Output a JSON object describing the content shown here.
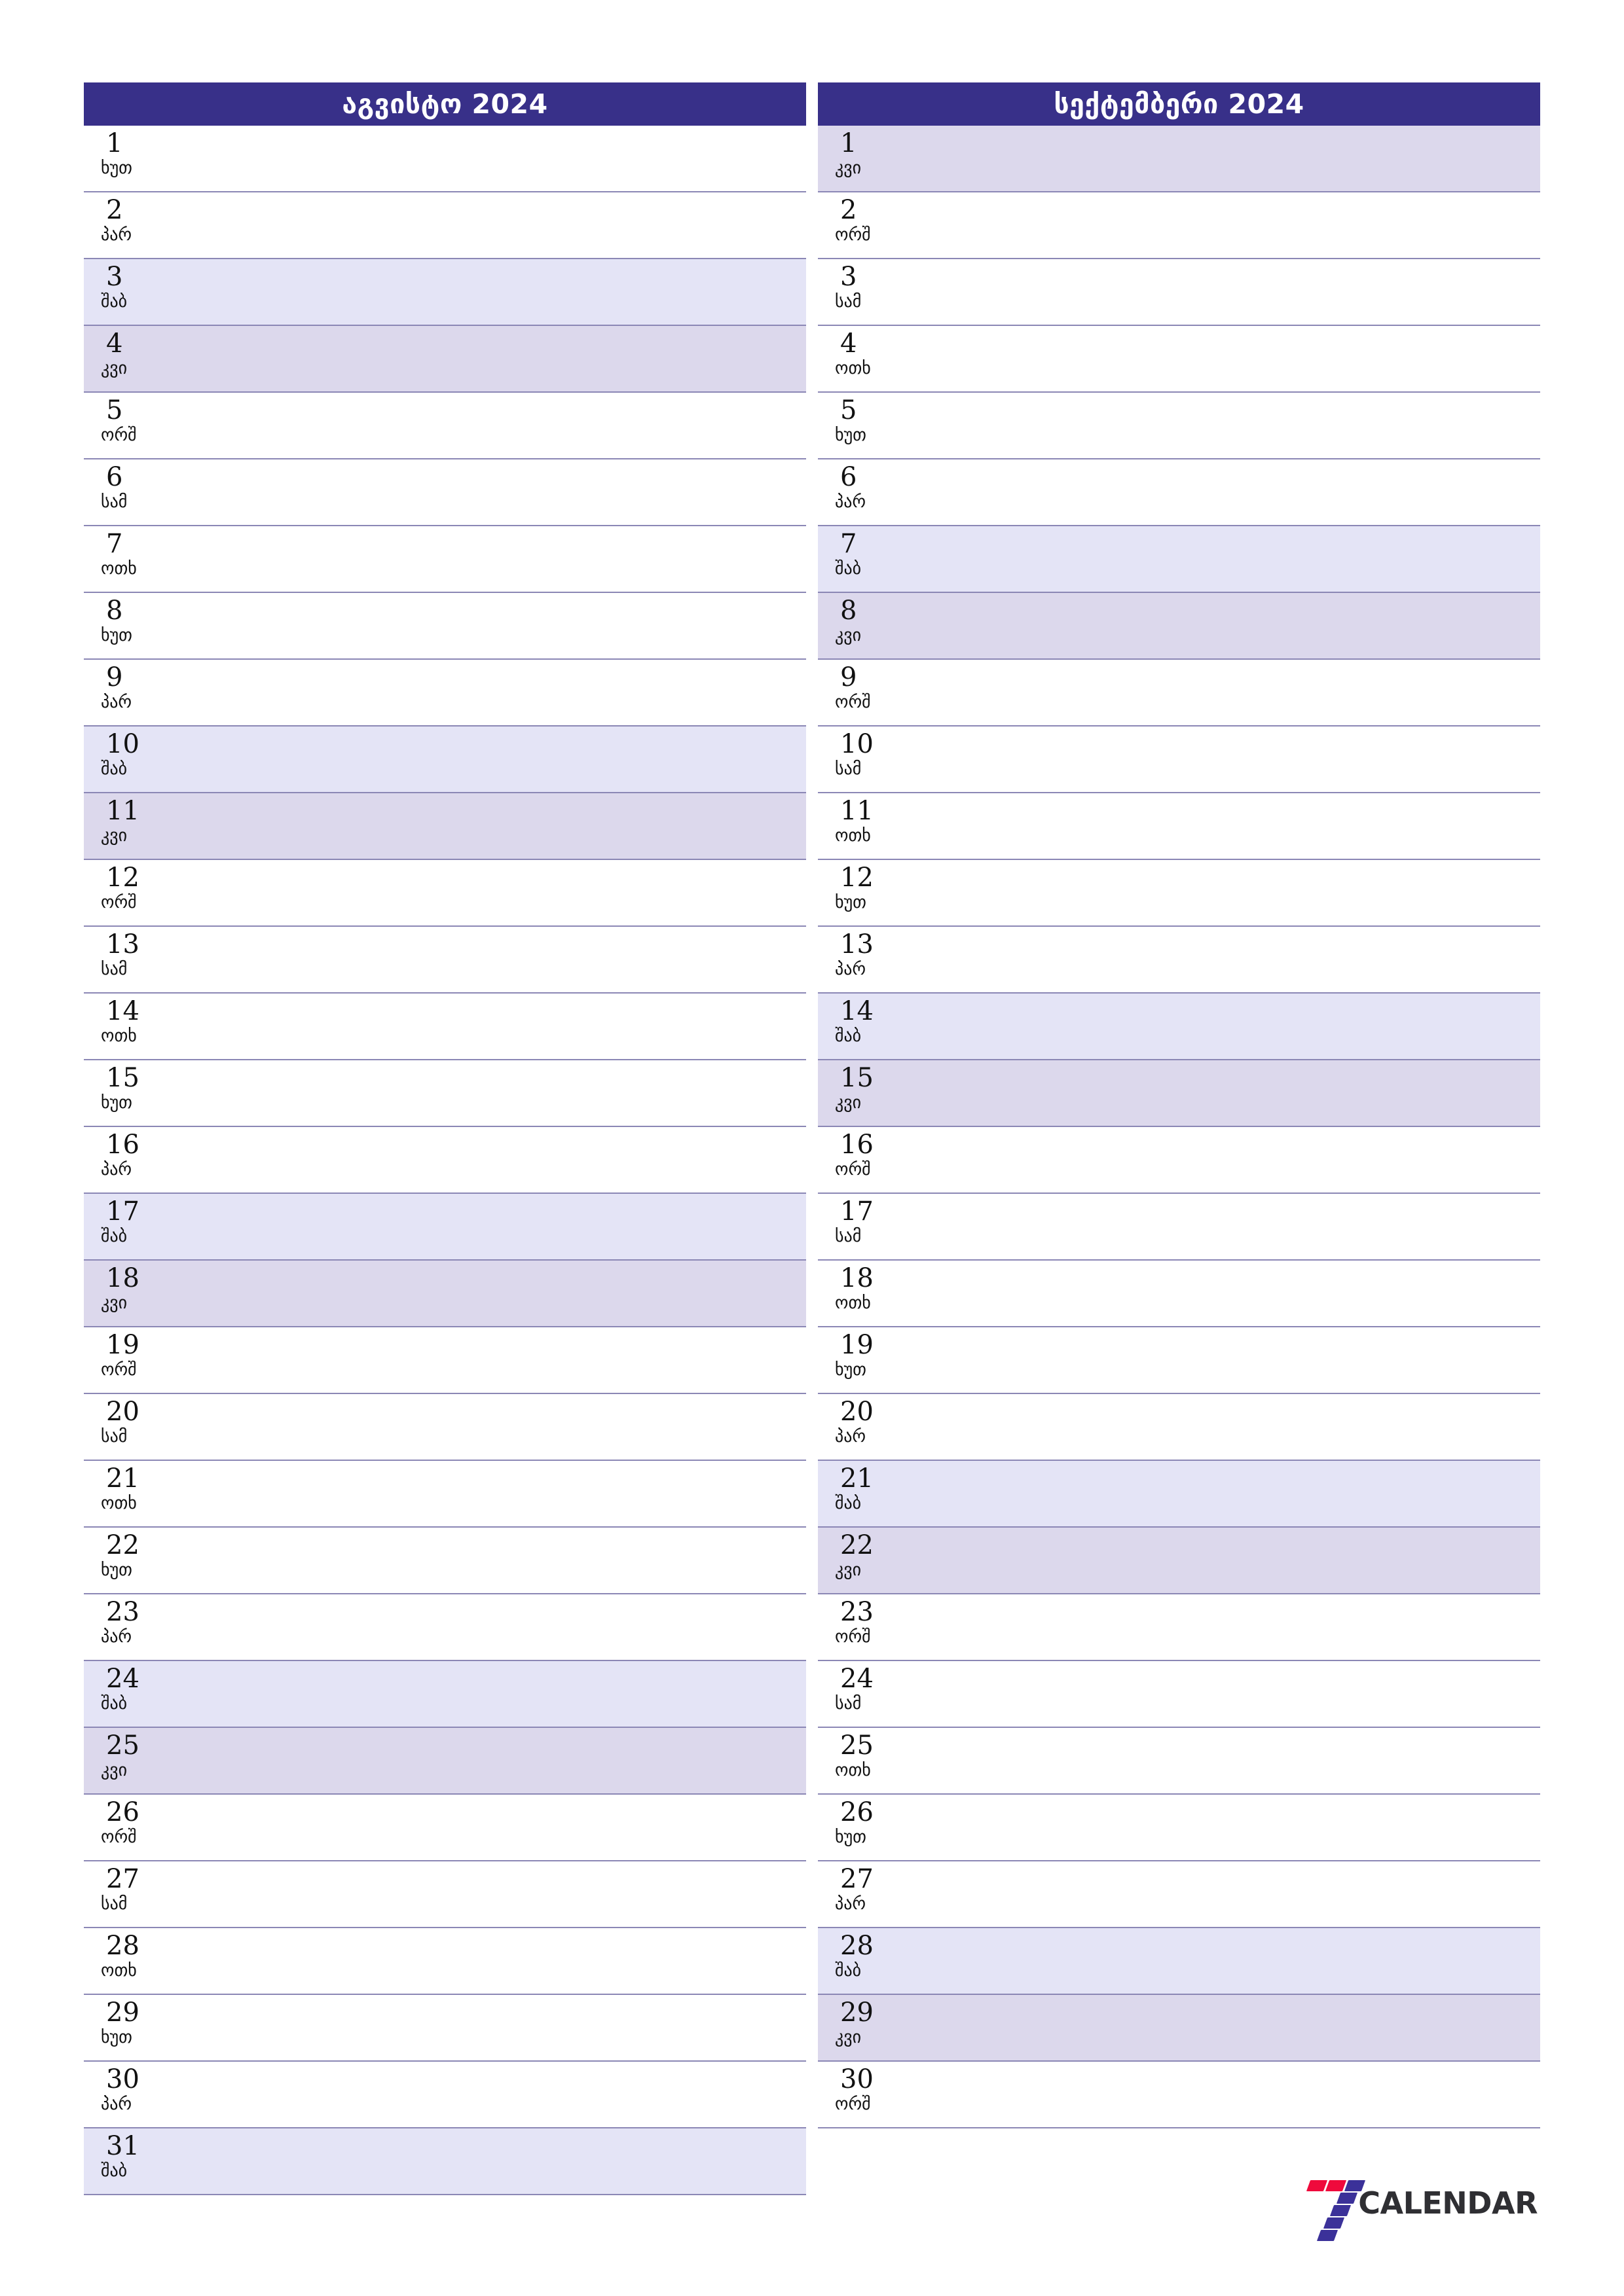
{
  "colors": {
    "header_bg": "#383089",
    "header_text": "#ffffff",
    "saturday_bg": "#e4e4f6",
    "sunday_bg": "#dcd8ec",
    "row_divider": "#8b87b5",
    "logo_red": "#ef0a3c",
    "logo_purple": "#3b3199",
    "logo_text": "#2f2f33"
  },
  "logo": {
    "mark_name": "seven-logo-mark",
    "text": "CALENDAR"
  },
  "months": [
    {
      "title": "აგვისტო 2024",
      "days": [
        {
          "num": "1",
          "name": "ხუთ",
          "type": "weekday"
        },
        {
          "num": "2",
          "name": "პარ",
          "type": "weekday"
        },
        {
          "num": "3",
          "name": "შაბ",
          "type": "sat"
        },
        {
          "num": "4",
          "name": "კვი",
          "type": "sun"
        },
        {
          "num": "5",
          "name": "ორშ",
          "type": "weekday"
        },
        {
          "num": "6",
          "name": "სამ",
          "type": "weekday"
        },
        {
          "num": "7",
          "name": "ოთხ",
          "type": "weekday"
        },
        {
          "num": "8",
          "name": "ხუთ",
          "type": "weekday"
        },
        {
          "num": "9",
          "name": "პარ",
          "type": "weekday"
        },
        {
          "num": "10",
          "name": "შაბ",
          "type": "sat"
        },
        {
          "num": "11",
          "name": "კვი",
          "type": "sun"
        },
        {
          "num": "12",
          "name": "ორშ",
          "type": "weekday"
        },
        {
          "num": "13",
          "name": "სამ",
          "type": "weekday"
        },
        {
          "num": "14",
          "name": "ოთხ",
          "type": "weekday"
        },
        {
          "num": "15",
          "name": "ხუთ",
          "type": "weekday"
        },
        {
          "num": "16",
          "name": "პარ",
          "type": "weekday"
        },
        {
          "num": "17",
          "name": "შაბ",
          "type": "sat"
        },
        {
          "num": "18",
          "name": "კვი",
          "type": "sun"
        },
        {
          "num": "19",
          "name": "ორშ",
          "type": "weekday"
        },
        {
          "num": "20",
          "name": "სამ",
          "type": "weekday"
        },
        {
          "num": "21",
          "name": "ოთხ",
          "type": "weekday"
        },
        {
          "num": "22",
          "name": "ხუთ",
          "type": "weekday"
        },
        {
          "num": "23",
          "name": "პარ",
          "type": "weekday"
        },
        {
          "num": "24",
          "name": "შაბ",
          "type": "sat"
        },
        {
          "num": "25",
          "name": "კვი",
          "type": "sun"
        },
        {
          "num": "26",
          "name": "ორშ",
          "type": "weekday"
        },
        {
          "num": "27",
          "name": "სამ",
          "type": "weekday"
        },
        {
          "num": "28",
          "name": "ოთხ",
          "type": "weekday"
        },
        {
          "num": "29",
          "name": "ხუთ",
          "type": "weekday"
        },
        {
          "num": "30",
          "name": "პარ",
          "type": "weekday"
        },
        {
          "num": "31",
          "name": "შაბ",
          "type": "sat"
        }
      ]
    },
    {
      "title": "სექტემბერი 2024",
      "days": [
        {
          "num": "1",
          "name": "კვი",
          "type": "sun"
        },
        {
          "num": "2",
          "name": "ორშ",
          "type": "weekday"
        },
        {
          "num": "3",
          "name": "სამ",
          "type": "weekday"
        },
        {
          "num": "4",
          "name": "ოთხ",
          "type": "weekday"
        },
        {
          "num": "5",
          "name": "ხუთ",
          "type": "weekday"
        },
        {
          "num": "6",
          "name": "პარ",
          "type": "weekday"
        },
        {
          "num": "7",
          "name": "შაბ",
          "type": "sat"
        },
        {
          "num": "8",
          "name": "კვი",
          "type": "sun"
        },
        {
          "num": "9",
          "name": "ორშ",
          "type": "weekday"
        },
        {
          "num": "10",
          "name": "სამ",
          "type": "weekday"
        },
        {
          "num": "11",
          "name": "ოთხ",
          "type": "weekday"
        },
        {
          "num": "12",
          "name": "ხუთ",
          "type": "weekday"
        },
        {
          "num": "13",
          "name": "პარ",
          "type": "weekday"
        },
        {
          "num": "14",
          "name": "შაბ",
          "type": "sat"
        },
        {
          "num": "15",
          "name": "კვი",
          "type": "sun"
        },
        {
          "num": "16",
          "name": "ორშ",
          "type": "weekday"
        },
        {
          "num": "17",
          "name": "სამ",
          "type": "weekday"
        },
        {
          "num": "18",
          "name": "ოთხ",
          "type": "weekday"
        },
        {
          "num": "19",
          "name": "ხუთ",
          "type": "weekday"
        },
        {
          "num": "20",
          "name": "პარ",
          "type": "weekday"
        },
        {
          "num": "21",
          "name": "შაბ",
          "type": "sat"
        },
        {
          "num": "22",
          "name": "კვი",
          "type": "sun"
        },
        {
          "num": "23",
          "name": "ორშ",
          "type": "weekday"
        },
        {
          "num": "24",
          "name": "სამ",
          "type": "weekday"
        },
        {
          "num": "25",
          "name": "ოთხ",
          "type": "weekday"
        },
        {
          "num": "26",
          "name": "ხუთ",
          "type": "weekday"
        },
        {
          "num": "27",
          "name": "პარ",
          "type": "weekday"
        },
        {
          "num": "28",
          "name": "შაბ",
          "type": "sat"
        },
        {
          "num": "29",
          "name": "კვი",
          "type": "sun"
        },
        {
          "num": "30",
          "name": "ორშ",
          "type": "weekday"
        }
      ]
    }
  ]
}
